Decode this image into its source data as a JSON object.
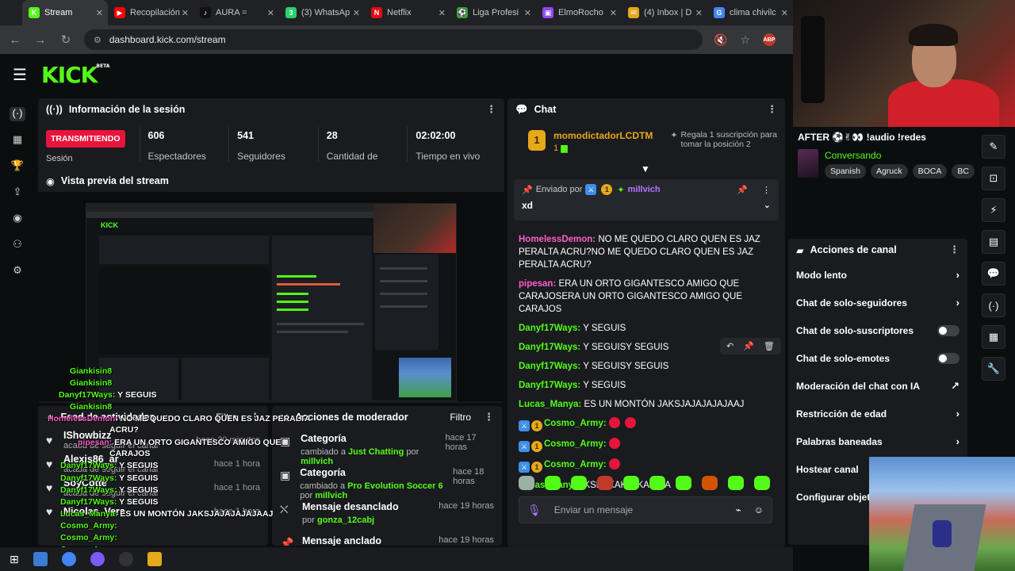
{
  "browser": {
    "tabs": [
      {
        "label": "Stream",
        "color": "#53fc18",
        "glyph": "K",
        "active": true
      },
      {
        "label": "Recopilación",
        "color": "#ff0000",
        "glyph": "▶"
      },
      {
        "label": "AURA = ",
        "color": "#111111",
        "glyph": "♪"
      },
      {
        "label": "(3) WhatsAp",
        "color": "#25d366",
        "glyph": "3"
      },
      {
        "label": "Netflix",
        "color": "#e50914",
        "glyph": "N"
      },
      {
        "label": "Liga Profesi",
        "color": "#3a9d3a",
        "glyph": "⚽"
      },
      {
        "label": "ElmoRocho",
        "color": "#9146ff",
        "glyph": "▣"
      },
      {
        "label": "(4) Inbox | D",
        "color": "#e6a919",
        "glyph": "✉"
      },
      {
        "label": "clima chivilc",
        "color": "#4285f4",
        "glyph": "G"
      }
    ],
    "url": "dashboard.kick.com/stream",
    "abp": "ABP"
  },
  "kick": {
    "logo": "KICK",
    "beta": "BETA"
  },
  "session": {
    "title": "Información de la sesión",
    "live_badge": "TRANSMITIENDO",
    "session_label": "Sesión",
    "stats": [
      {
        "value": "606",
        "label": "Espectadores"
      },
      {
        "value": "541",
        "label": "Seguidores"
      },
      {
        "value": "28",
        "label": "Cantidad de"
      },
      {
        "value": "02:02:00",
        "label": "Tiempo en vivo"
      }
    ]
  },
  "preview": {
    "title": "Vista previa del stream"
  },
  "feed": {
    "title": "Feed de actividades",
    "filter": "Filtro",
    "items": [
      {
        "name": "IShowbizz",
        "sub": "acaba de seguir el canal",
        "time": "hace 30 minutos"
      },
      {
        "name": "Alexis86_ar",
        "sub": "acaba de seguir el canal",
        "time": "hace 1 hora"
      },
      {
        "name": "SoyCotte",
        "sub": "acaba de seguir el canal",
        "time": "hace 1 hora"
      },
      {
        "name": "Nicolas_Vera",
        "sub": "",
        "time": "hace 1 hora"
      }
    ]
  },
  "overlay": [
    {
      "user": "Giankisin8",
      "msg": "",
      "tone": "g"
    },
    {
      "user": "Giankisin8",
      "msg": "",
      "tone": "g"
    },
    {
      "user": "Danyf17Ways:",
      "msg": "Y SEGUIS",
      "tone": "g"
    },
    {
      "user": "Giankisin8",
      "msg": "",
      "tone": "g"
    },
    {
      "user": "HomelessDemon:",
      "msg": "NO ME QUEDO CLARO QUEN ES JAZ PERALTA",
      "tone": "r"
    },
    {
      "user": "",
      "msg": "ACRU?",
      "tone": "w"
    },
    {
      "user": "pipesan:",
      "msg": "ERA UN ORTO GIGANTESCO AMIGO QUE",
      "tone": "r"
    },
    {
      "user": "",
      "msg": "CARAJOS",
      "tone": "w"
    },
    {
      "user": "Danyf17Ways:",
      "msg": "Y SEGUIS",
      "tone": "g"
    },
    {
      "user": "Danyf17Ways:",
      "msg": "Y SEGUIS",
      "tone": "g"
    },
    {
      "user": "Danyf17Ways:",
      "msg": "Y SEGUIS",
      "tone": "g"
    },
    {
      "user": "Danyf17Ways:",
      "msg": "Y SEGUIS",
      "tone": "g"
    },
    {
      "user": "Lucas_Manya:",
      "msg": "ES UN MONTÓN JAKSJAJAJAJAJAAJ",
      "tone": "g"
    },
    {
      "user": "Cosmo_Army:",
      "msg": "",
      "tone": "g"
    },
    {
      "user": "Cosmo_Army:",
      "msg": "",
      "tone": "g"
    },
    {
      "user": "Cosmo_Army:",
      "msg": "",
      "tone": "g"
    },
    {
      "user": "Lucas_Manya:",
      "msg": "KSKSKAKJAKAJAJA",
      "tone": "g"
    }
  ],
  "mod": {
    "title": "Acciones de moderador",
    "filter": "Filtro",
    "items": [
      {
        "title": "Categoría",
        "pre": "cambiado a",
        "target": "Just Chatting",
        "mid": "por",
        "by": "millvich",
        "time": "hace 17 horas",
        "icon": "category"
      },
      {
        "title": "Categoría",
        "pre": "cambiado a",
        "target": "Pro Evolution Soccer 6",
        "mid": "por",
        "by": "millvich",
        "time": "hace 18 horas",
        "icon": "category"
      },
      {
        "title": "Mensaje desanclado",
        "pre": "por",
        "target": "gonza_12cabj",
        "mid": "",
        "by": "",
        "time": "hace 19 horas",
        "icon": "unpin"
      },
      {
        "title": "Mensaje anclado",
        "pre": "",
        "target": "",
        "mid": "",
        "by": "",
        "time": "hace 19 horas",
        "icon": "pin"
      }
    ]
  },
  "chat": {
    "title": "Chat",
    "gift": {
      "user": "momodictadorLCDTM",
      "count": "1",
      "text": "Regala 1 suscripción para tomar la posición 2"
    },
    "pinned": {
      "label": "Enviado por",
      "user": "millvich",
      "message": "xd"
    },
    "messages": [
      {
        "user": "HomelessDemon:",
        "color": "#ff5dcb",
        "text": "NO ME QUEDO CLARO QUEN ES JAZ PERALTA ACRU?NO ME QUEDO CLARO QUEN ES JAZ PERALTA ACRU?"
      },
      {
        "user": "pipesan:",
        "color": "#ff5dcb",
        "text": "ERA UN ORTO GIGANTESCO AMIGO QUE CARAJOSERA UN ORTO GIGANTESCO AMIGO QUE CARAJOS"
      },
      {
        "user": "Danyf17Ways:",
        "color": "#53fc18",
        "text": "Y SEGUIS"
      },
      {
        "user": "Danyf17Ways:",
        "color": "#53fc18",
        "text": "Y SEGUISY SEGUIS"
      },
      {
        "user": "Danyf17Ways:",
        "color": "#53fc18",
        "text": "Y SEGUISY SEGUIS"
      },
      {
        "user": "Danyf17Ways:",
        "color": "#53fc18",
        "text": "Y SEGUIS"
      },
      {
        "user": "Lucas_Manya:",
        "color": "#53fc18",
        "text": "ES UN MONTÓN JAKSJAJAJAJAJAAJ"
      },
      {
        "user": "Cosmo_Army:",
        "color": "#53fc18",
        "text": "",
        "badges": true,
        "emotes": 2
      },
      {
        "user": "Cosmo_Army:",
        "color": "#53fc18",
        "text": "",
        "badges": true,
        "emotes": 1
      },
      {
        "user": "Cosmo_Army:",
        "color": "#53fc18",
        "text": "",
        "badges": true,
        "emotes": 1
      },
      {
        "user": "Lucas_Manya:",
        "color": "#53fc18",
        "text": "KSKSKAKJAKAJAJA"
      }
    ],
    "input_placeholder": "Enviar un mensaje"
  },
  "stream_info": {
    "title": "AFTER ⚽✌👀 !audio !redes",
    "category": "Conversando",
    "tags": [
      "Spanish",
      "Agruck",
      "BOCA",
      "BC"
    ]
  },
  "channel_actions": {
    "title": "Acciones de canal",
    "items": [
      {
        "label": "Modo lento",
        "type": "arrow"
      },
      {
        "label": "Chat de solo-seguidores",
        "type": "arrow"
      },
      {
        "label": "Chat de solo-suscriptores",
        "type": "toggle"
      },
      {
        "label": "Chat de solo-emotes",
        "type": "toggle"
      },
      {
        "label": "Moderación del chat con IA",
        "type": "link"
      },
      {
        "label": "Restricción de edad",
        "type": "arrow"
      },
      {
        "label": "Palabras baneadas",
        "type": "arrow"
      },
      {
        "label": "Hostear canal",
        "type": "none"
      },
      {
        "label": "Configurar objetivo",
        "type": "none"
      }
    ]
  },
  "colors": {
    "accent": "#53fc18",
    "live": "#e8143a",
    "card": "#191b1f",
    "bg": "#0b0e0f"
  }
}
